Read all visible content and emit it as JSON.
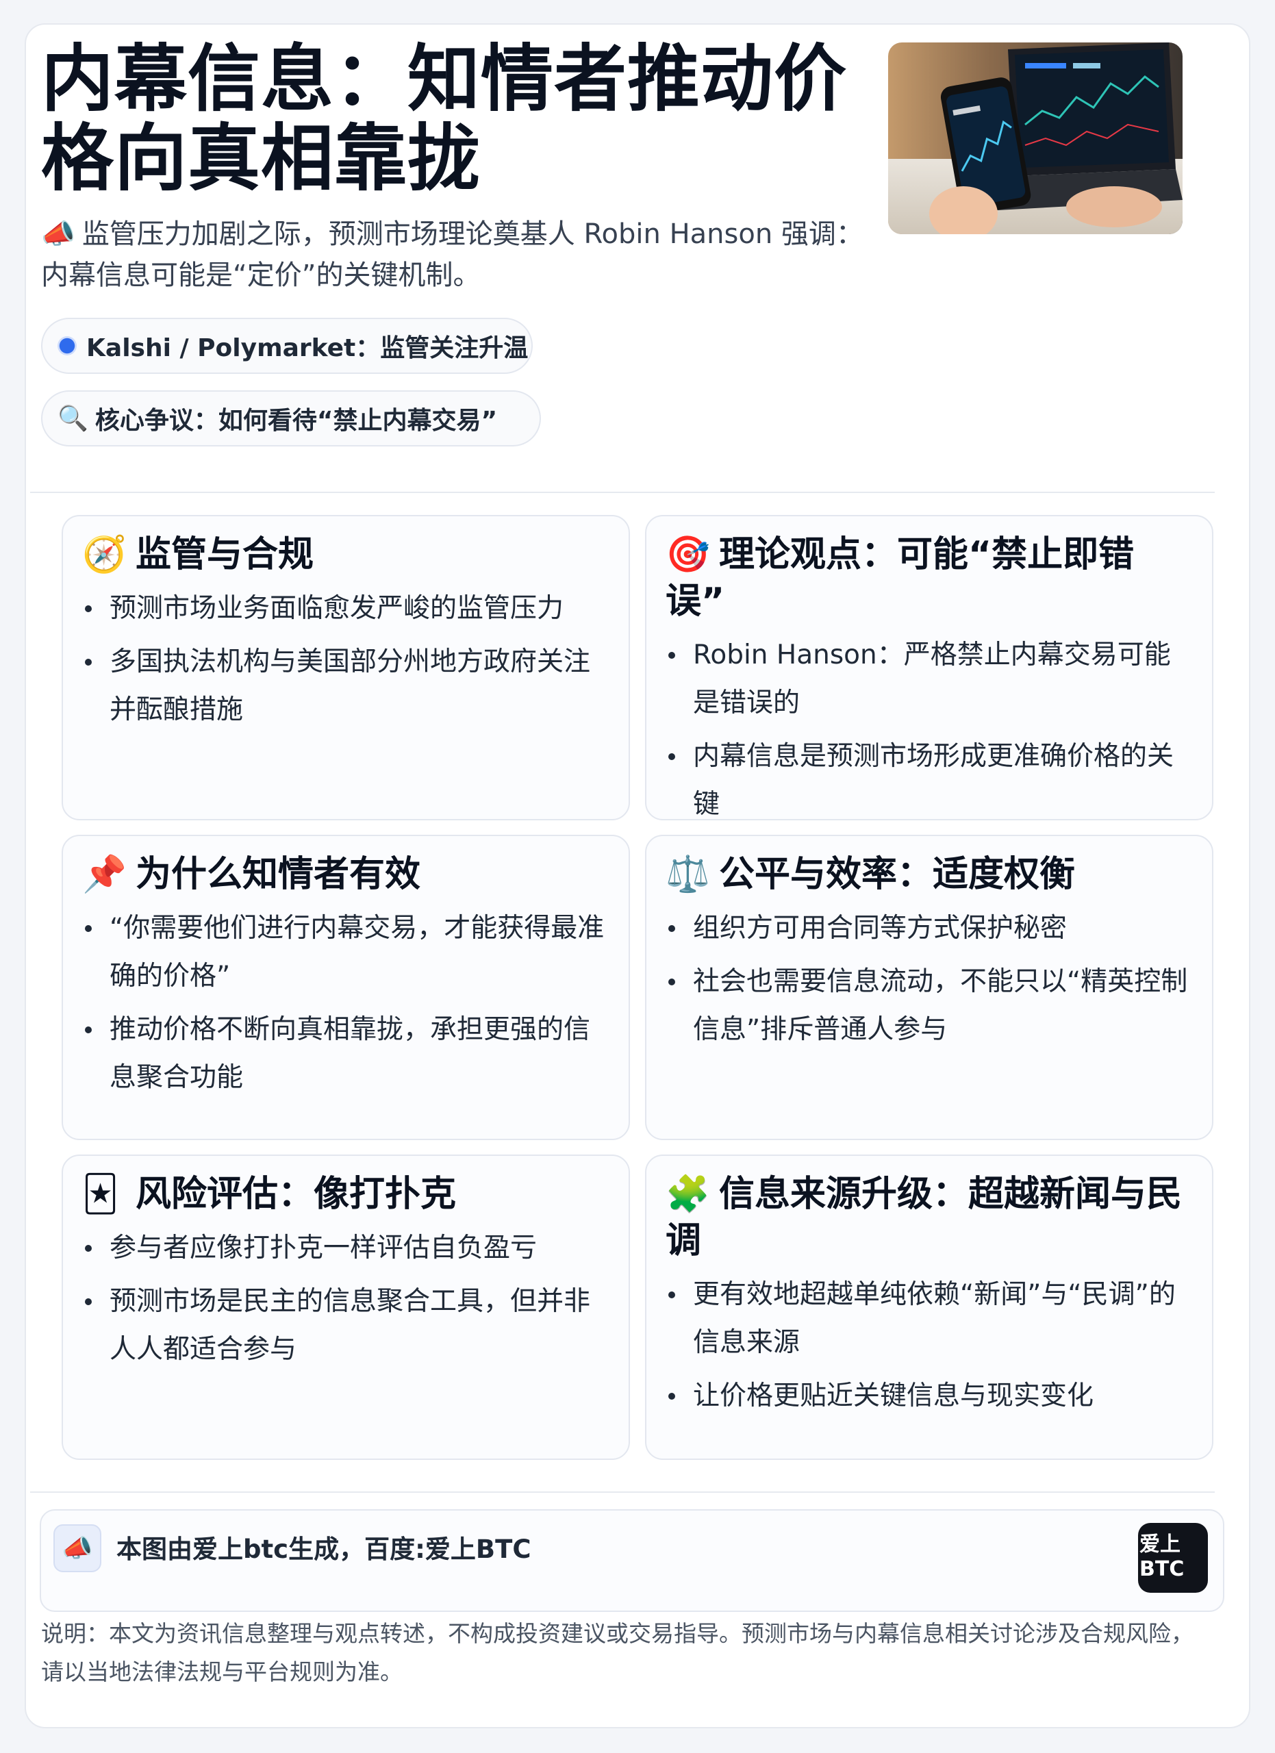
{
  "header": {
    "title": "内幕信息：知情者推动价格向真相靠拢",
    "subtitle_icon": "megaphone-icon",
    "subtitle": "监管压力加剧之际，预测市场理论奠基人 Robin Hanson 强调：内幕信息可能是“定价”的关键机制。",
    "tags": [
      {
        "icon": "blue-dot-icon",
        "label": "Kalshi / Polymarket：监管关注升温"
      },
      {
        "icon": "magnifier-icon",
        "label": "核心争议：如何看待“禁止内幕交易”"
      }
    ]
  },
  "cards": [
    {
      "icon": "compass-icon",
      "title": "监管与合规",
      "items": [
        "预测市场业务面临愈发严峻的监管压力",
        "多国执法机构与美国部分州地方政府关注并酝酿措施"
      ]
    },
    {
      "icon": "target-icon",
      "title": "理论观点：可能“禁止即错误”",
      "items": [
        "Robin Hanson：严格禁止内幕交易可能是错误的",
        "内幕信息是预测市场形成更准确价格的关键"
      ]
    },
    {
      "icon": "pushpin-icon",
      "title": "为什么知情者有效",
      "items": [
        "“你需要他们进行内幕交易，才能获得最准确的价格”",
        "推动价格不断向真相靠拢，承担更强的信息聚合功能"
      ]
    },
    {
      "icon": "balance-scale-icon",
      "title": "公平与效率：适度权衡",
      "items": [
        "组织方可用合同等方式保护秘密",
        "社会也需要信息流动，不能只以“精英控制信息”排斥普通人参与"
      ]
    },
    {
      "icon": "joker-card-icon",
      "title": "风险评估：像打扑克",
      "items": [
        "参与者应像打扑克一样评估自负盈亏",
        "预测市场是民主的信息聚合工具，但并非人人都适合参与"
      ]
    },
    {
      "icon": "puzzle-piece-icon",
      "title": "信息来源升级：超越新闻与民调",
      "items": [
        "更有效地超越单纯依赖“新闻”与“民调”的信息来源",
        "让价格更贴近关键信息与现实变化"
      ]
    }
  ],
  "footer": {
    "icon": "megaphone-icon",
    "text": "本图由爱上btc生成，百度:爱上BTC",
    "badge_line1": "爱上",
    "badge_line2": "BTC"
  },
  "disclaimer": "说明：本文为资讯信息整理与观点转述，不构成投资建议或交易指导。预测市场与内幕信息相关讨论涉及合规风险，请以当地法律法规与平台规则为准。"
}
